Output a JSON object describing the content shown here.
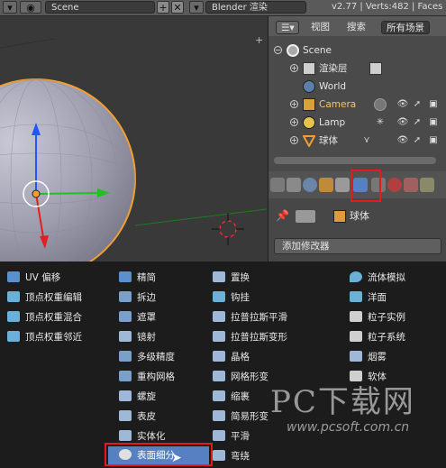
{
  "header": {
    "scene_label": "Scene",
    "add_symbol": "+",
    "close_symbol": "✕",
    "engine_label": "Blender 渲染",
    "version_stats": "v2.77 | Verts:482 | Faces"
  },
  "outliner": {
    "tabs": [
      "视图",
      "搜索",
      "所有场景"
    ],
    "rows": [
      {
        "label": "Scene",
        "icon": "scene-icon"
      },
      {
        "label": "渲染层",
        "icon": "render-layers-icon"
      },
      {
        "label": "World",
        "icon": "world-icon"
      },
      {
        "label": "Camera",
        "icon": "camera-icon"
      },
      {
        "label": "Lamp",
        "icon": "lamp-icon"
      },
      {
        "label": "球体",
        "icon": "mesh-icon"
      }
    ]
  },
  "properties": {
    "object_name": "球体",
    "add_modifier_label": "添加修改器"
  },
  "modifier_menu": {
    "col1": [
      "UV 偏移",
      "顶点权重编辑",
      "顶点权重混合",
      "顶点权重邻近"
    ],
    "col2": [
      "精简",
      "拆边",
      "遮罩",
      "镜射",
      "多级精度",
      "重构网格",
      "螺旋",
      "表皮",
      "实体化",
      "表面细分"
    ],
    "col3": [
      "置换",
      "钩挂",
      "拉普拉斯平滑",
      "拉普拉斯变形",
      "晶格",
      "网格形变",
      "缩裹",
      "简易形变",
      "平滑",
      "弯绕"
    ],
    "col4": [
      "流体模拟",
      "洋面",
      "粒子实例",
      "粒子系统",
      "烟雾",
      "软体"
    ],
    "highlighted": "表面细分"
  },
  "watermark": {
    "title": "PC下载网",
    "url": "www.pcsoft.com.cn"
  },
  "colors": {
    "highlight": "#5680c2",
    "annotation_red": "#e21b1b",
    "selection_orange": "#f0a030"
  }
}
